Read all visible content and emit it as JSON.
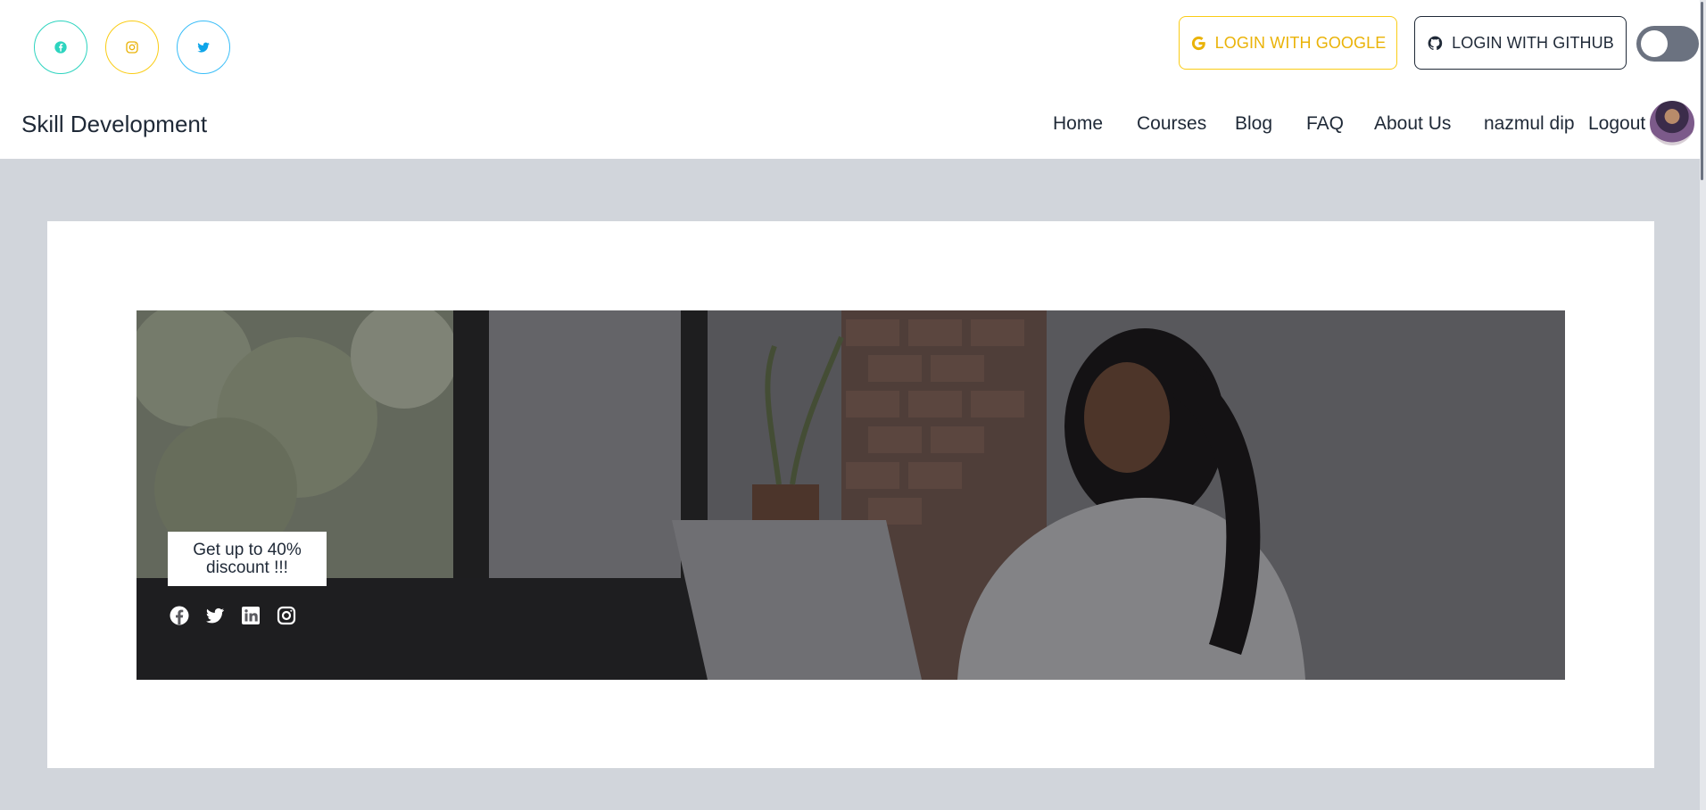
{
  "header": {
    "social": [
      {
        "name": "facebook",
        "icon": "facebook-icon",
        "color": "#2dd4bf"
      },
      {
        "name": "instagram",
        "icon": "instagram-icon",
        "color": "#facc15"
      },
      {
        "name": "twitter",
        "icon": "twitter-icon",
        "color": "#38bdf8"
      }
    ],
    "login_google_label": "LOGIN WITH GOOGLE",
    "login_github_label": "LOGIN WITH GITHUB",
    "theme_toggle": {
      "state": "off"
    },
    "brand": "Skill Development",
    "nav": {
      "home": "Home",
      "courses": "Courses",
      "blog": "Blog",
      "faq": "FAQ",
      "about": "About Us",
      "user": "nazmul dip",
      "logout": "Logout"
    }
  },
  "banner": {
    "discount_text": "Get up to 40% discount !!!",
    "icons": [
      "facebook-icon",
      "twitter-icon",
      "linkedin-icon",
      "instagram-icon"
    ]
  },
  "colors": {
    "accent_teal": "#2dd4bf",
    "accent_yellow": "#eab308",
    "accent_sky": "#0ea5e9",
    "text_dark": "#1f2937",
    "page_bg": "#d1d5db"
  }
}
